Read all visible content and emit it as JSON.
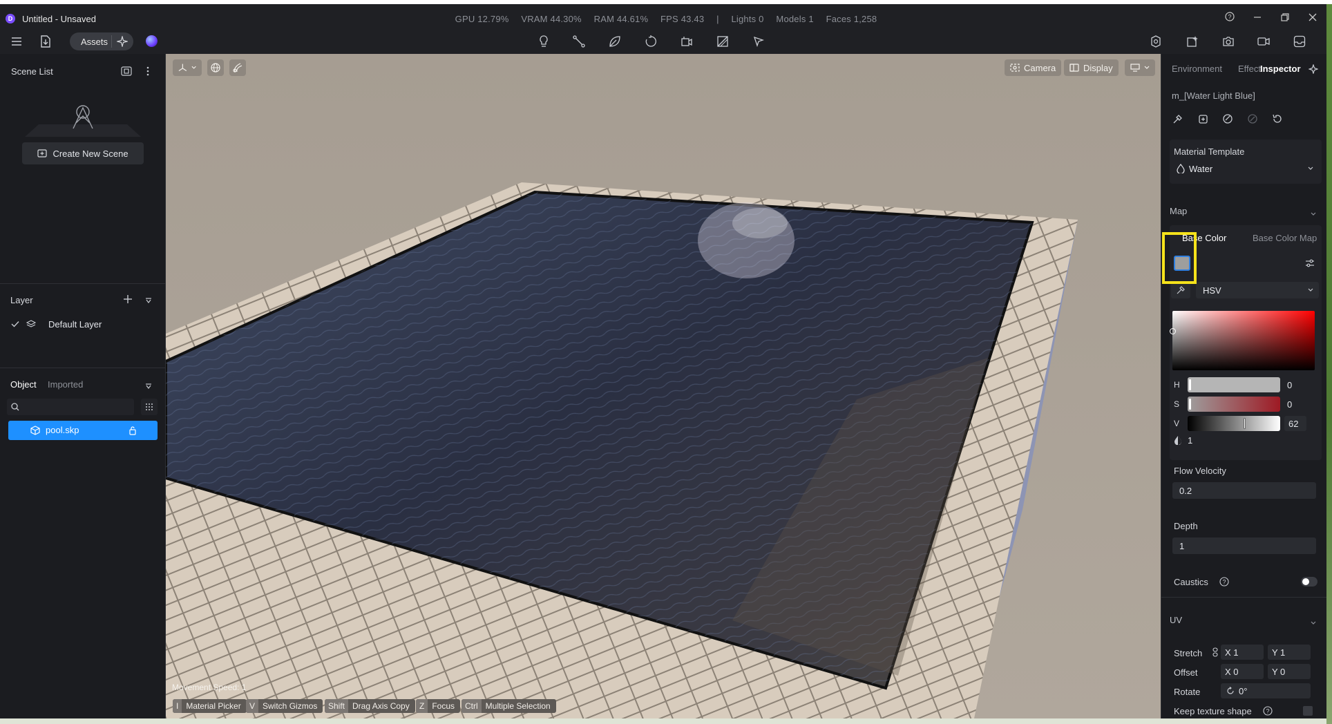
{
  "window": {
    "title": "Untitled - Unsaved",
    "stats": [
      "GPU 12.79%",
      "VRAM 44.30%",
      "RAM 44.61%",
      "FPS 43.43",
      "|",
      "Lights 0",
      "Models 1",
      "Faces 1,258"
    ]
  },
  "toolbar": {
    "assets_label": "Assets",
    "center_icons": [
      "light-icon",
      "path-icon",
      "leaf-icon",
      "rotate-icon",
      "video-icon",
      "section-icon",
      "measure-icon"
    ],
    "right_icons": [
      "render-icon",
      "enhance-icon",
      "camera-icon",
      "video-record-icon",
      "inbox-icon"
    ]
  },
  "scene_list": {
    "title": "Scene List",
    "create_label": "Create New Scene"
  },
  "layer": {
    "title": "Layer",
    "items": [
      {
        "label": "Default Layer"
      }
    ]
  },
  "objects": {
    "tab_object": "Object",
    "tab_imported": "Imported",
    "items": [
      {
        "label": "pool.skp"
      }
    ]
  },
  "viewport": {
    "camera_label": "Camera",
    "display_label": "Display",
    "movement_speed": "Movement Speed: 1",
    "hints": [
      {
        "key": "I",
        "text": "Material Picker"
      },
      {
        "key": "V",
        "text": "Switch Gizmos"
      },
      {
        "key": "Shift",
        "text": "Drag Axis Copy"
      },
      {
        "key": "Z",
        "text": "Focus"
      },
      {
        "key": "Ctrl",
        "text": "Multiple Selection"
      }
    ]
  },
  "inspector": {
    "tabs": [
      "Environment",
      "Effect",
      "Inspector"
    ],
    "material_name": "m_[Water Light Blue]",
    "template_label": "Material Template",
    "template_value": "Water",
    "map_label": "Map",
    "base_color_tab": "Base Color",
    "base_color_map_tab": "Base Color Map",
    "color_mode": "HSV",
    "swatch_color": "#9e9e9e",
    "h_label": "H",
    "h_value": "0",
    "s_label": "S",
    "s_value": "0",
    "v_label": "V",
    "v_value": "62",
    "alpha_value": "1",
    "flow_velocity_label": "Flow Velocity",
    "flow_velocity_value": "0.2",
    "depth_label": "Depth",
    "depth_value": "1",
    "caustics_label": "Caustics",
    "uv_label": "UV",
    "stretch_label": "Stretch",
    "stretch_x": "X 1",
    "stretch_y": "Y 1",
    "offset_label": "Offset",
    "offset_x": "X 0",
    "offset_y": "Y 0",
    "rotate_label": "Rotate",
    "rotate_value": "0°",
    "keep_shape_label": "Keep texture shape"
  },
  "colors": {
    "accent": "#1e90ff",
    "highlight": "#f5e21b"
  }
}
